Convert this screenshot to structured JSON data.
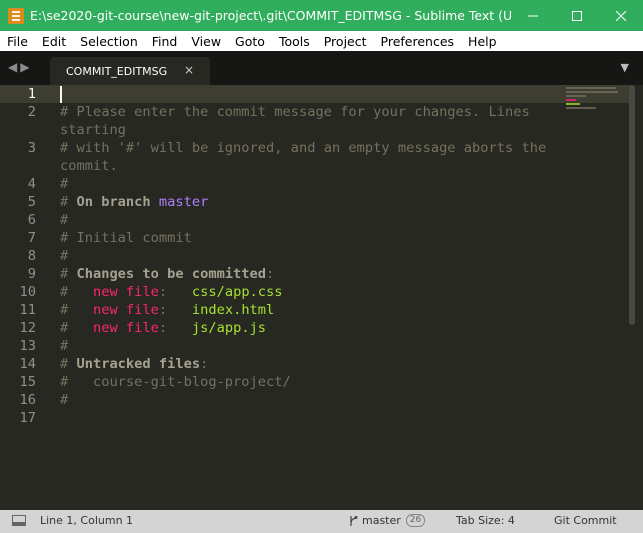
{
  "window": {
    "title": "E:\\se2020-git-course\\new-git-project\\.git\\COMMIT_EDITMSG - Sublime Text (U...",
    "accent": "#31ae5d"
  },
  "menu": [
    "File",
    "Edit",
    "Selection",
    "Find",
    "View",
    "Goto",
    "Tools",
    "Project",
    "Preferences",
    "Help"
  ],
  "tab": {
    "label": "COMMIT_EDITMSG",
    "close": "×"
  },
  "editor": {
    "line_numbers": [
      "1",
      "2",
      "3",
      "4",
      "5",
      "6",
      "7",
      "8",
      "9",
      "10",
      "11",
      "12",
      "13",
      "14",
      "15",
      "16",
      "17"
    ],
    "lines": {
      "l2a": "# Please enter the commit message for your changes. Lines",
      "l2b": "starting",
      "l3a": "# with '#' will be ignored, and an empty message aborts the",
      "l3b": "commit.",
      "l4": "#",
      "l5_hash": "# ",
      "l5_label": "On branch",
      "l5_branch": "master",
      "l6": "#",
      "l7": "# Initial commit",
      "l8": "#",
      "l9_hash": "# ",
      "l9_label": "Changes to be committed",
      "l9_colon": ":",
      "l10_hash": "#   ",
      "l10_status": "new file",
      "l10_colon": ":   ",
      "l10_file": "css/app.css",
      "l11_hash": "#   ",
      "l11_status": "new file",
      "l11_colon": ":   ",
      "l11_file": "index.html",
      "l12_hash": "#   ",
      "l12_status": "new file",
      "l12_colon": ":   ",
      "l12_file": "js/app.js",
      "l13": "#",
      "l14_hash": "# ",
      "l14_label": "Untracked files",
      "l14_colon": ":",
      "l15": "#   course-git-blog-project/",
      "l16": "#"
    }
  },
  "status": {
    "position": "Line 1, Column 1",
    "branch": "master",
    "branch_count": "26",
    "tab_size": "Tab Size: 4",
    "syntax": "Git Commit"
  }
}
